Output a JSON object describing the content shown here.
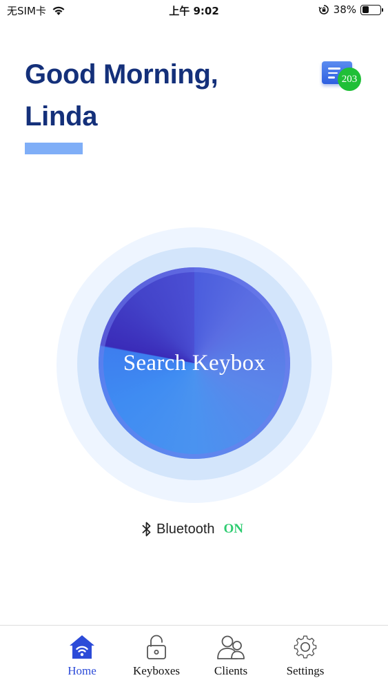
{
  "status_bar": {
    "carrier": "无SIM卡",
    "time": "上午 9:02",
    "battery": "38%",
    "battery_level": 0.38
  },
  "greeting": {
    "line1": "Good Morning,",
    "line2": "Linda"
  },
  "messages": {
    "icon": "message-list-icon",
    "count": "203"
  },
  "search": {
    "label": "Search Keybox"
  },
  "bluetooth": {
    "icon": "bluetooth-icon",
    "label": "Bluetooth",
    "status": "ON"
  },
  "tabs": [
    {
      "label": "Home",
      "icon": "home-wifi-icon",
      "active": true
    },
    {
      "label": "Keyboxes",
      "icon": "padlock-icon",
      "active": false
    },
    {
      "label": "Clients",
      "icon": "users-icon",
      "active": false
    },
    {
      "label": "Settings",
      "icon": "gear-icon",
      "active": false
    }
  ],
  "colors": {
    "primary": "#14307a",
    "accent": "#2c4bd8",
    "badge": "#1fbf37",
    "bluetooth_on": "#2ecc71"
  }
}
